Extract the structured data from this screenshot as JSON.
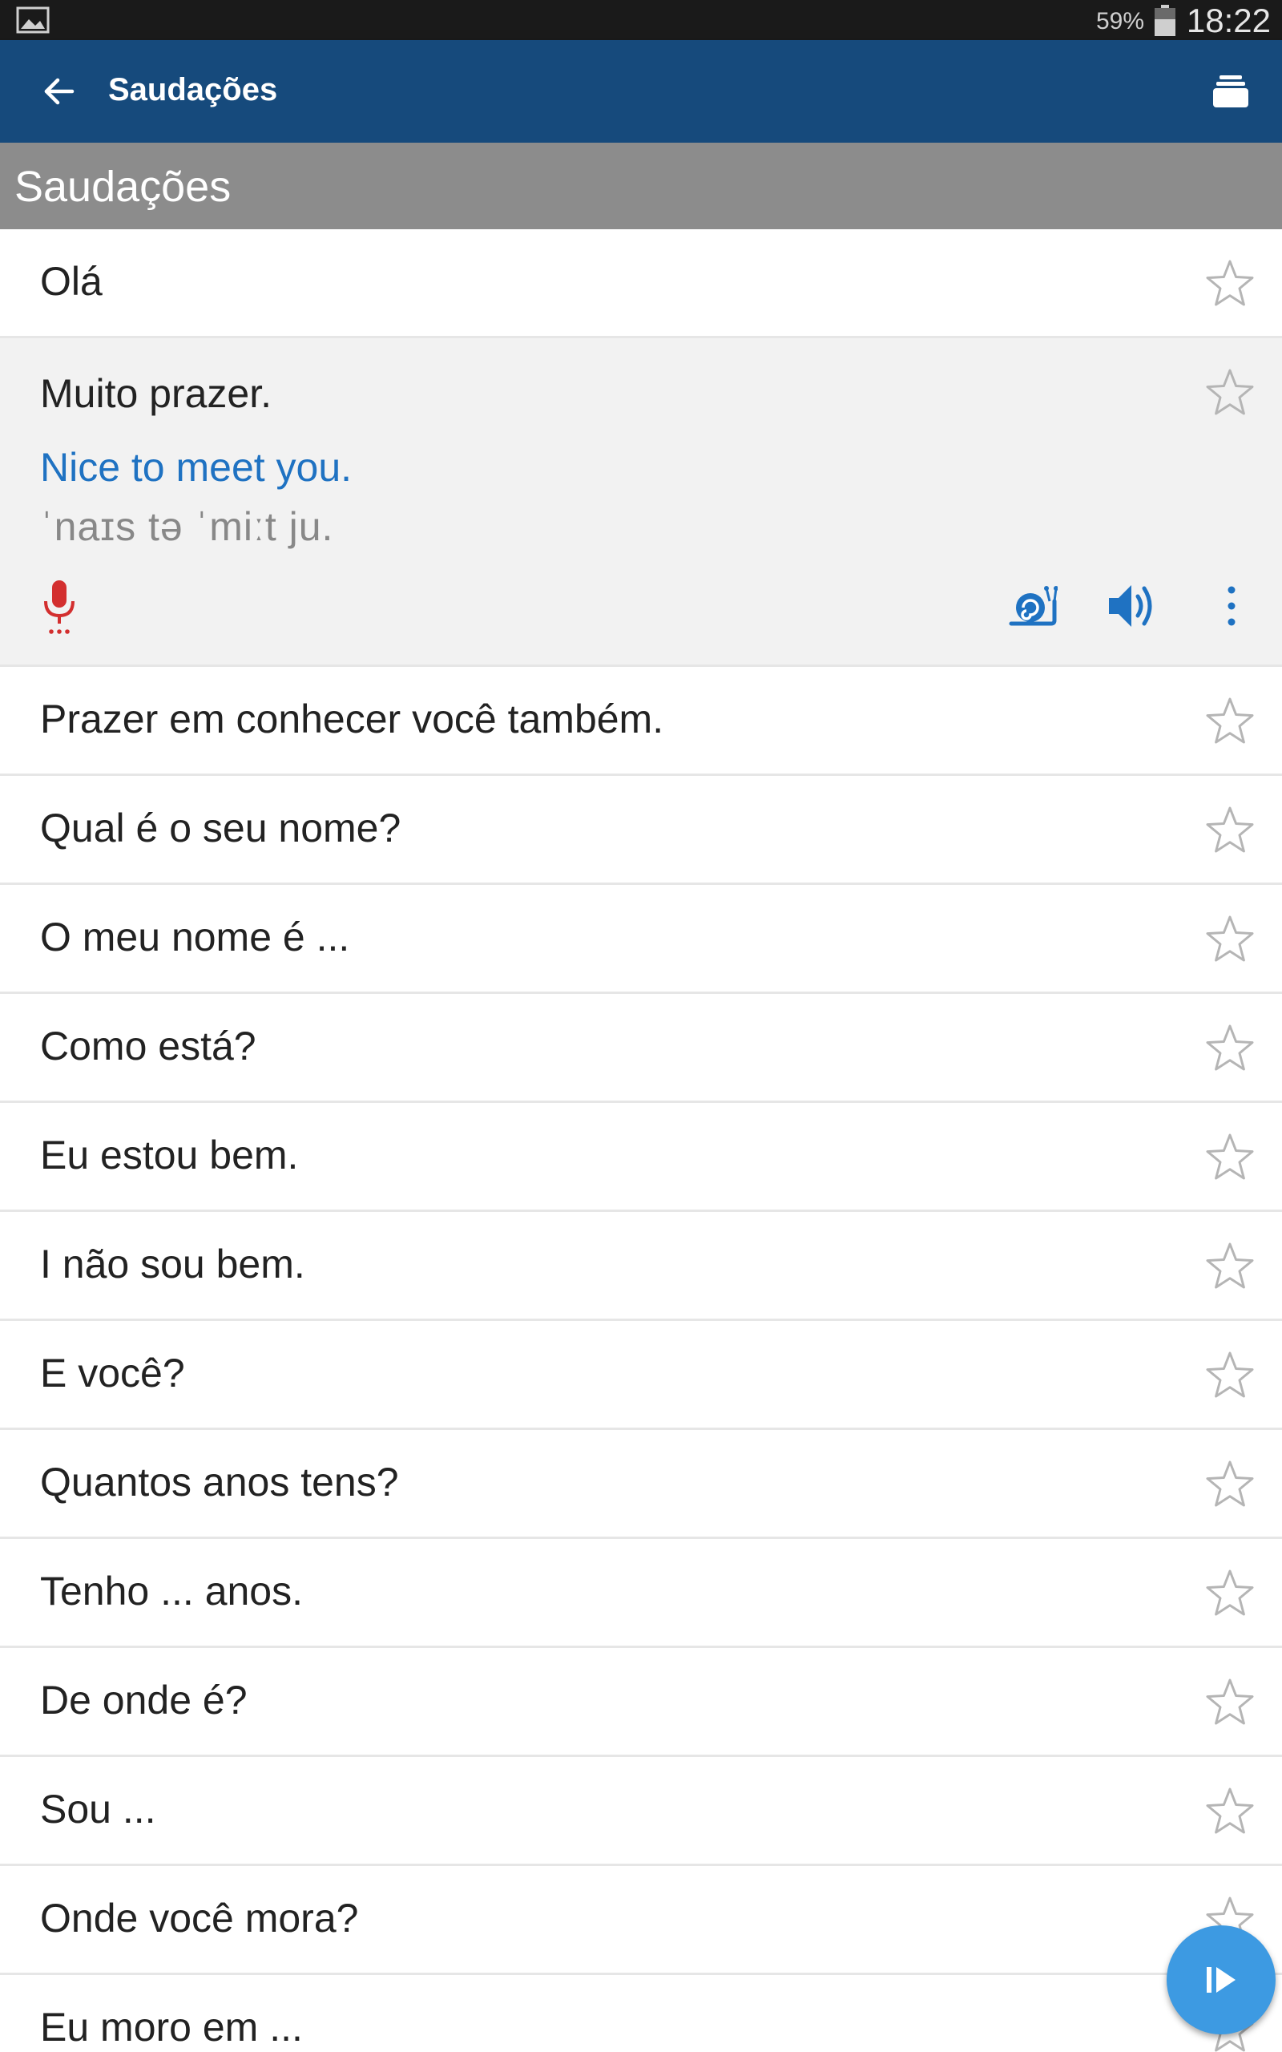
{
  "status_bar": {
    "battery": "59%",
    "time": "18:22",
    "icons": [
      "gallery-icon",
      "battery-icon"
    ]
  },
  "app_bar": {
    "title": "Saudações",
    "icons": [
      "back-arrow-icon",
      "stack-icon"
    ]
  },
  "section": {
    "label": "Saudações"
  },
  "rows": [
    {
      "phrase": "Olá"
    },
    {
      "phrase": "Muito prazer.",
      "translation": "Nice to meet you.",
      "phonetic": "ˈnaɪs tə ˈmiːt ju.",
      "expanded": true,
      "actions": [
        "mic-icon",
        "snail-icon",
        "speaker-icon",
        "more-icon"
      ]
    },
    {
      "phrase": "Prazer em conhecer você também."
    },
    {
      "phrase": "Qual é o seu nome?"
    },
    {
      "phrase": "O meu nome é ..."
    },
    {
      "phrase": "Como está?"
    },
    {
      "phrase": "Eu estou bem."
    },
    {
      "phrase": "I não sou bem."
    },
    {
      "phrase": "E você?"
    },
    {
      "phrase": "Quantos anos tens?"
    },
    {
      "phrase": "Tenho ... anos."
    },
    {
      "phrase": "De onde é?"
    },
    {
      "phrase": "Sou ..."
    },
    {
      "phrase": "Onde você mora?"
    },
    {
      "phrase": "Eu moro em ..."
    }
  ],
  "colors": {
    "app_bar": "#164a7c",
    "section_header": "#8c8c8c",
    "translation": "#1f72c2",
    "mic": "#d32f2f",
    "fab": "#3d9ae2"
  },
  "fab": {
    "icon": "play-icon"
  }
}
